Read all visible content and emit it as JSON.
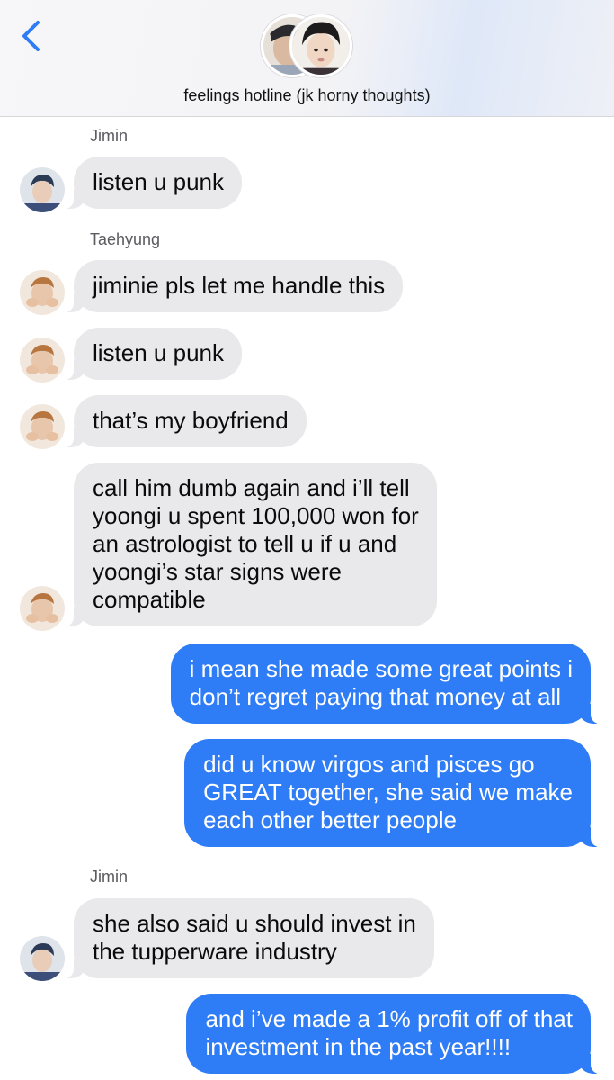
{
  "header": {
    "title": "feelings hotline (jk horny thoughts)",
    "back_icon": "chevron-left-icon",
    "accent_color": "#2e7cf6"
  },
  "messages": [
    {
      "type": "sender",
      "text": "Jimin"
    },
    {
      "type": "in",
      "sender": "Jimin",
      "text": "listen u punk"
    },
    {
      "type": "sender",
      "text": "Taehyung"
    },
    {
      "type": "in",
      "sender": "Taehyung",
      "text": "jiminie pls let me handle this"
    },
    {
      "type": "in",
      "sender": "Taehyung",
      "text": "listen u punk"
    },
    {
      "type": "in",
      "sender": "Taehyung",
      "text": "that’s my boyfriend"
    },
    {
      "type": "in",
      "sender": "Taehyung",
      "text": "call him dumb again and i’ll tell\nyoongi u spent 100,000 won for\nan astrologist to tell u if u and\nyoongi’s star signs were\ncompatible"
    },
    {
      "type": "out",
      "text": "i mean she made some great points i\ndon’t regret paying that money at all"
    },
    {
      "type": "out",
      "text": "did u know virgos and pisces go\nGREAT together, she said we make\neach other better people"
    },
    {
      "type": "sender",
      "text": "Jimin"
    },
    {
      "type": "in",
      "sender": "Jimin",
      "text": "she also said u should invest in\nthe tupperware industry"
    },
    {
      "type": "out",
      "text": "and i’ve made a 1% profit off of that\ninvestment in the past year!!!!"
    }
  ],
  "colors": {
    "incoming_bubble": "#e9e9eb",
    "outgoing_bubble": "#2e7cf6"
  }
}
